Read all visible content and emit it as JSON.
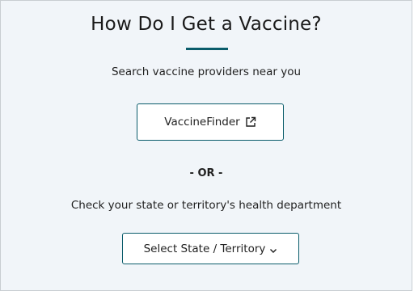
{
  "card": {
    "title": "How Do I Get a Vaccine?",
    "subtitle": "Search vaccine providers near you",
    "finder_button_label": "VaccineFinder",
    "or_label": "- OR -",
    "state_text": "Check your state or territory's health department",
    "state_select_value": "Select State / Territory"
  },
  "icons": {
    "finder": "external-link-icon",
    "select": "chevron-down-icon"
  },
  "colors": {
    "panel_background": "#f1f5f9",
    "accent": "#0a5c6b",
    "text": "#1f1f1f"
  }
}
